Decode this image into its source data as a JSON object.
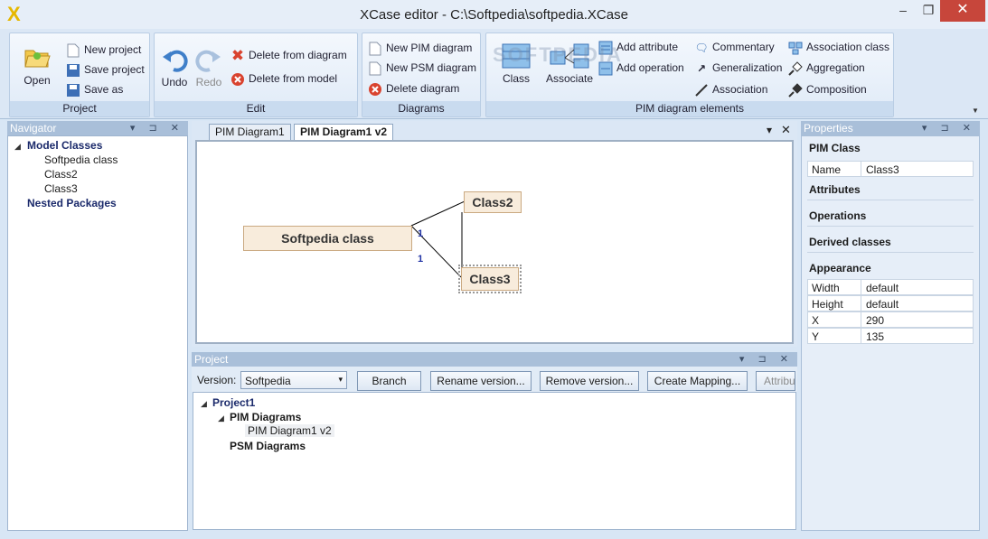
{
  "window": {
    "title": "XCase editor - C:\\Softpedia\\softpedia.XCase",
    "logo": "X",
    "minimize": "–",
    "maximize": "❐",
    "close": "✕"
  },
  "ribbon": {
    "project": {
      "caption": "Project",
      "open": "Open",
      "new_project": "New project",
      "save_project": "Save project",
      "save_as": "Save as"
    },
    "edit": {
      "caption": "Edit",
      "undo": "Undo",
      "redo": "Redo",
      "delete_from_diagram": "Delete from diagram",
      "delete_from_model": "Delete from model"
    },
    "diagrams": {
      "caption": "Diagrams",
      "new_pim": "New PIM diagram",
      "new_psm": "New PSM diagram",
      "delete": "Delete diagram"
    },
    "pim_elements": {
      "caption": "PIM diagram elements",
      "class": "Class",
      "associate": "Associate",
      "add_attribute": "Add attribute",
      "add_operation": "Add operation",
      "commentary": "Commentary",
      "generalization": "Generalization",
      "association": "Association",
      "association_class": "Association class",
      "aggregation": "Aggregation",
      "composition": "Composition"
    }
  },
  "navigator": {
    "title": "Navigator",
    "root": "Model Classes",
    "items": [
      "Softpedia class",
      "Class2",
      "Class3"
    ],
    "packages": "Nested Packages"
  },
  "diagram": {
    "tabs": [
      "PIM Diagram1",
      "PIM Diagram1 v2"
    ],
    "classes": {
      "softpedia": "Softpedia class",
      "class2": "Class2",
      "class3": "Class3"
    },
    "multiplicity_1": "1",
    "multiplicity_2": "1"
  },
  "project": {
    "title": "Project",
    "version_label": "Version:",
    "version_value": "Softpedia",
    "buttons": {
      "branch": "Branch",
      "rename": "Rename version...",
      "remove": "Remove version...",
      "mapping": "Create Mapping...",
      "attrib": "Attribu"
    },
    "tree": {
      "root": "Project1",
      "pim": "PIM Diagrams",
      "pim_child": "PIM Diagram1 v2",
      "psm": "PSM Diagrams"
    }
  },
  "properties": {
    "title": "Properties",
    "header": "PIM Class",
    "name_key": "Name",
    "name_value": "Class3",
    "attributes": "Attributes",
    "operations": "Operations",
    "derived": "Derived classes",
    "appearance": "Appearance",
    "rows": [
      {
        "k": "Width",
        "v": "default"
      },
      {
        "k": "Height",
        "v": "default"
      },
      {
        "k": "X",
        "v": "290"
      },
      {
        "k": "Y",
        "v": "135"
      }
    ]
  },
  "watermark": "SOFTPEDIA"
}
